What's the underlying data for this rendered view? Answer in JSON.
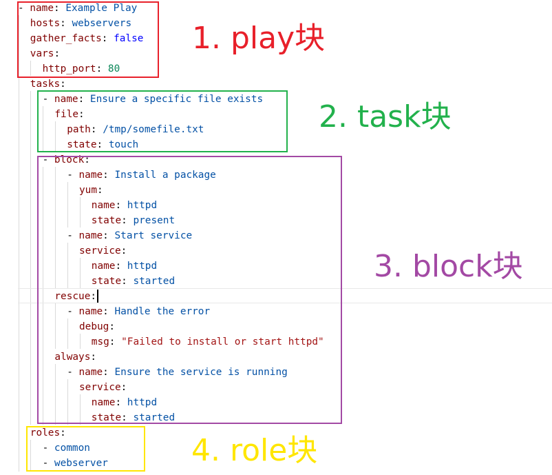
{
  "code_lines": [
    {
      "indent": 0,
      "dash": "- ",
      "key": "name",
      "value": "Example Play",
      "vtype": "str"
    },
    {
      "indent": 1,
      "dash": "",
      "key": "hosts",
      "value": "webservers",
      "vtype": "str"
    },
    {
      "indent": 1,
      "dash": "",
      "key": "gather_facts",
      "value": "false",
      "vtype": "bool"
    },
    {
      "indent": 1,
      "dash": "",
      "key": "vars",
      "value": "",
      "vtype": "none"
    },
    {
      "indent": 2,
      "dash": "",
      "key": "http_port",
      "value": "80",
      "vtype": "num"
    },
    {
      "indent": 1,
      "dash": "",
      "key": "tasks",
      "value": "",
      "vtype": "none"
    },
    {
      "indent": 2,
      "dash": "- ",
      "key": "name",
      "value": "Ensure a specific file exists",
      "vtype": "str"
    },
    {
      "indent": 3,
      "dash": "",
      "key": "file",
      "value": "",
      "vtype": "none"
    },
    {
      "indent": 4,
      "dash": "",
      "key": "path",
      "value": "/tmp/somefile.txt",
      "vtype": "str"
    },
    {
      "indent": 4,
      "dash": "",
      "key": "state",
      "value": "touch",
      "vtype": "str"
    },
    {
      "indent": 2,
      "dash": "- ",
      "key": "block",
      "value": "",
      "vtype": "none"
    },
    {
      "indent": 4,
      "dash": "- ",
      "key": "name",
      "value": "Install a package",
      "vtype": "str"
    },
    {
      "indent": 5,
      "dash": "",
      "key": "yum",
      "value": "",
      "vtype": "none"
    },
    {
      "indent": 6,
      "dash": "",
      "key": "name",
      "value": "httpd",
      "vtype": "str"
    },
    {
      "indent": 6,
      "dash": "",
      "key": "state",
      "value": "present",
      "vtype": "str"
    },
    {
      "indent": 4,
      "dash": "- ",
      "key": "name",
      "value": "Start service",
      "vtype": "str"
    },
    {
      "indent": 5,
      "dash": "",
      "key": "service",
      "value": "",
      "vtype": "none"
    },
    {
      "indent": 6,
      "dash": "",
      "key": "name",
      "value": "httpd",
      "vtype": "str"
    },
    {
      "indent": 6,
      "dash": "",
      "key": "state",
      "value": "started",
      "vtype": "str"
    },
    {
      "indent": 3,
      "dash": "",
      "key": "rescue",
      "value": "",
      "vtype": "none"
    },
    {
      "indent": 4,
      "dash": "- ",
      "key": "name",
      "value": "Handle the error",
      "vtype": "str"
    },
    {
      "indent": 5,
      "dash": "",
      "key": "debug",
      "value": "",
      "vtype": "none"
    },
    {
      "indent": 6,
      "dash": "",
      "key": "msg",
      "value": "\"Failed to install or start httpd\"",
      "vtype": "qstr"
    },
    {
      "indent": 3,
      "dash": "",
      "key": "always",
      "value": "",
      "vtype": "none"
    },
    {
      "indent": 4,
      "dash": "- ",
      "key": "name",
      "value": "Ensure the service is running",
      "vtype": "str"
    },
    {
      "indent": 5,
      "dash": "",
      "key": "service",
      "value": "",
      "vtype": "none"
    },
    {
      "indent": 6,
      "dash": "",
      "key": "name",
      "value": "httpd",
      "vtype": "str"
    },
    {
      "indent": 6,
      "dash": "",
      "key": "state",
      "value": "started",
      "vtype": "str"
    },
    {
      "indent": 1,
      "dash": "",
      "key": "roles",
      "value": "",
      "vtype": "none"
    },
    {
      "indent": 2,
      "dash": "- ",
      "key": "",
      "value": "common",
      "vtype": "str"
    },
    {
      "indent": 2,
      "dash": "- ",
      "key": "",
      "value": "webserver",
      "vtype": "str"
    }
  ],
  "annotations": [
    {
      "id": "play",
      "label": "1. play块",
      "color": "#e8202a"
    },
    {
      "id": "task",
      "label": "2. task块",
      "color": "#22b14c"
    },
    {
      "id": "block",
      "label": "3. block块",
      "color": "#a349a4"
    },
    {
      "id": "role",
      "label": "4. role块",
      "color": "#ffe600"
    }
  ],
  "syntax_colors": {
    "key": "#800000",
    "string": "#0451a5",
    "boolean": "#0000ff",
    "number": "#098658",
    "quoted_string": "#a31515"
  }
}
